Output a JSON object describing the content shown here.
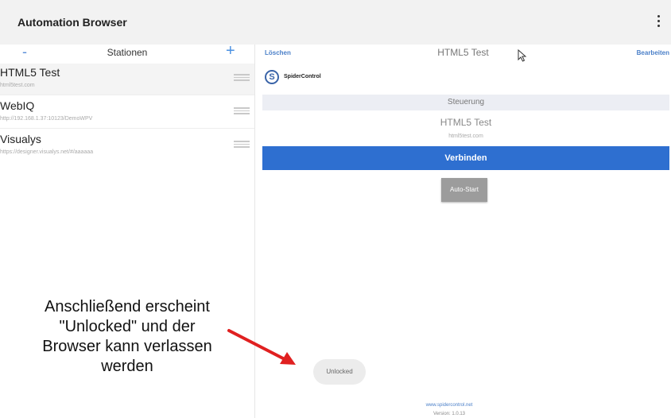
{
  "appbar": {
    "title": "Automation Browser",
    "more_icon": "more-vert-icon"
  },
  "stations": {
    "title": "Stationen",
    "minus_label": "-",
    "plus_label": "+",
    "items": [
      {
        "name": "HTML5 Test",
        "url": "html5test.com",
        "selected": true
      },
      {
        "name": "WebIQ",
        "url": "http://192.168.1.37:10123/DemoWPV",
        "selected": false
      },
      {
        "name": "Visualys",
        "url": "https://designer.visualys.net/#/aaaaaa",
        "selected": false
      }
    ]
  },
  "detail": {
    "delete_label": "Löschen",
    "edit_label": "Bearbeiten",
    "header_title": "HTML5 Test",
    "logo_text": "SpiderControl",
    "logo_mark": "S",
    "section_title": "Steuerung",
    "device_name": "HTML5 Test",
    "device_url": "html5test.com",
    "connect_label": "Verbinden",
    "autostart_label": "Auto-Start",
    "unlocked_label": "Unlocked",
    "footer_link": "www.spidercontrol.net",
    "footer_version": "Version: 1.0.13"
  },
  "annotation": {
    "lines": [
      "Anschließend erscheint",
      "\"Unlocked\" und der",
      "Browser kann verlassen",
      "werden"
    ],
    "arrow_color": "#e02020"
  },
  "colors": {
    "accent": "#2e6fd0",
    "link": "#4a7fc8"
  }
}
